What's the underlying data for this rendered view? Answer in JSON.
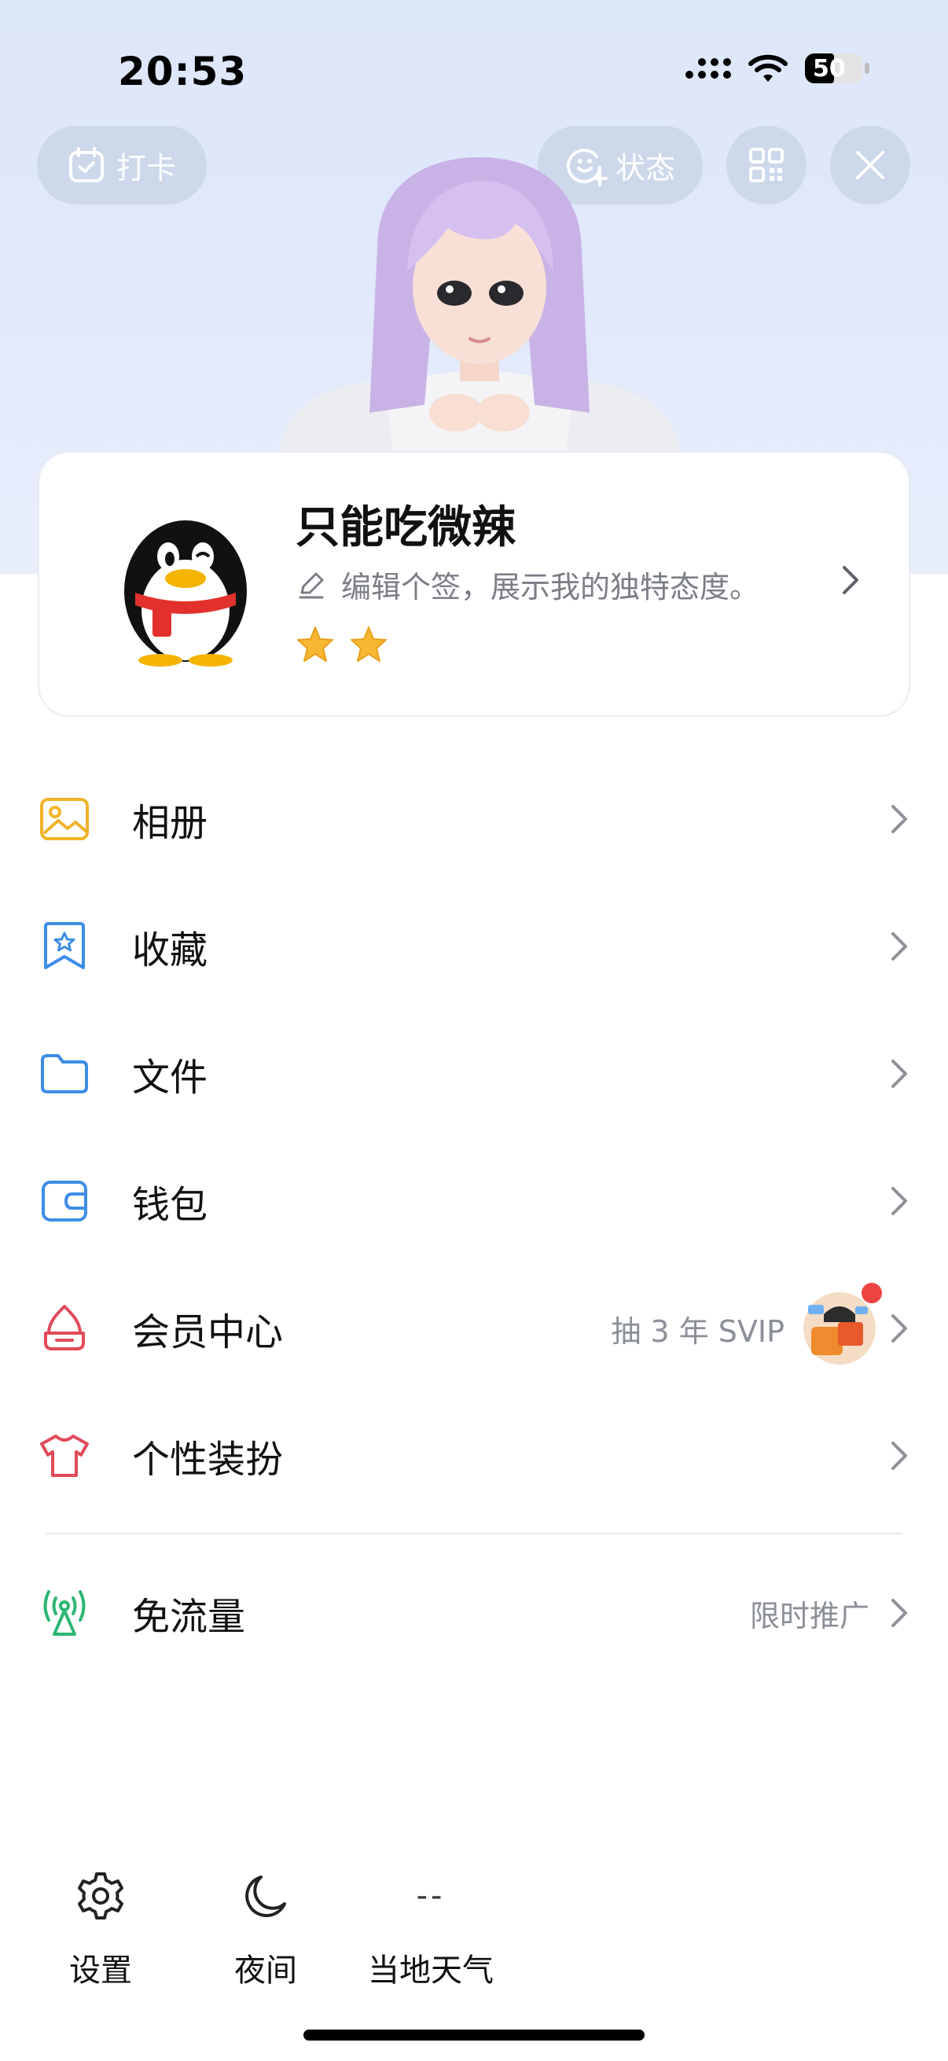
{
  "status_bar": {
    "time": "20:53",
    "battery": "50"
  },
  "header": {
    "checkin_label": "打卡",
    "status_label": "状态"
  },
  "profile": {
    "name": "只能吃微辣",
    "signature_placeholder": "编辑个签，展示我的独特态度。",
    "level_stars": 2
  },
  "menu": [
    {
      "label": "相册",
      "icon": "album-icon",
      "color": "#f0b429",
      "extra": ""
    },
    {
      "label": "收藏",
      "icon": "favorites-icon",
      "color": "#3d8de6",
      "extra": ""
    },
    {
      "label": "文件",
      "icon": "folder-icon",
      "color": "#3d8de6",
      "extra": ""
    },
    {
      "label": "钱包",
      "icon": "wallet-icon",
      "color": "#3d8de6",
      "extra": ""
    },
    {
      "label": "会员中心",
      "icon": "vip-crown-icon",
      "color": "#e04b5a",
      "extra": "抽 3 年 SVIP"
    },
    {
      "label": "个性装扮",
      "icon": "tshirt-icon",
      "color": "#e04b5a",
      "extra": ""
    },
    {
      "label": "免流量",
      "icon": "antenna-icon",
      "color": "#2bb673",
      "extra": "限时推广"
    }
  ],
  "tools": {
    "settings_label": "设置",
    "night_label": "夜间",
    "weather_value": "--",
    "weather_label": "当地天气"
  },
  "colors": {
    "header_bg": "#dde7fa",
    "accent_blue": "#3d8de6",
    "accent_red": "#e04b5a",
    "accent_yellow": "#f0b429",
    "accent_green": "#2bb673",
    "vip_badge_dot": "#ee4343"
  }
}
